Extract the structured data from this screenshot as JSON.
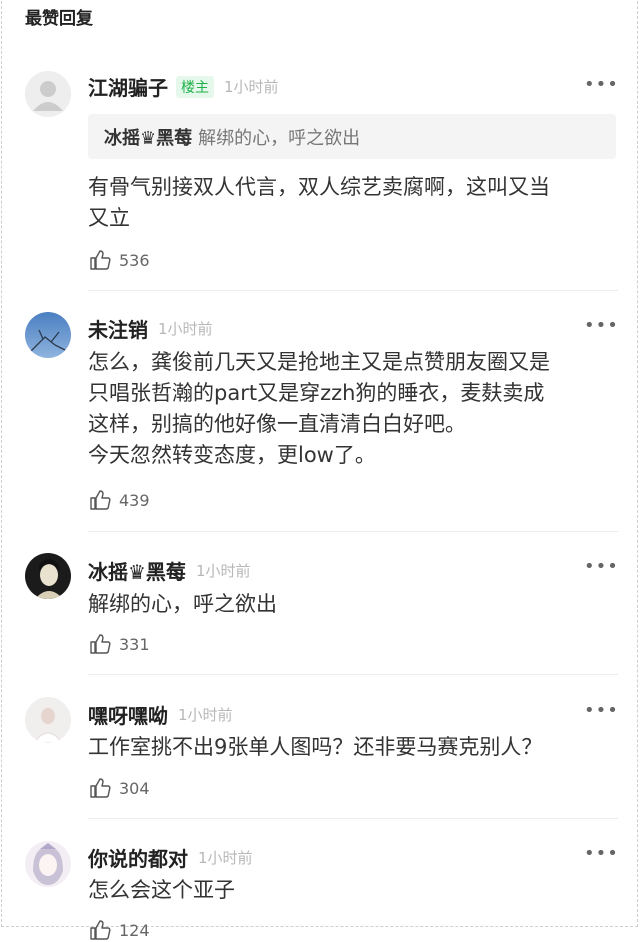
{
  "section_title": "最赞回复",
  "comments": [
    {
      "author": "江湖骗子",
      "badge": "楼主",
      "time": "1小时前",
      "more": "•••",
      "quote": {
        "author": "冰摇♛黑莓",
        "text": "解绑的心，呼之欲出"
      },
      "lines": [
        "有骨气别接双人代言，双人综艺卖腐啊，这叫又当",
        "又立"
      ],
      "likes": "536",
      "avatar": "default-avatar"
    },
    {
      "author": "未注销",
      "time": "1小时前",
      "more": "•••",
      "lines": [
        "怎么，龚俊前几天又是抢地主又是点赞朋友圈又是",
        "只唱张哲瀚的part又是穿zzh狗的睡衣，麦麸卖成",
        "这样，别搞的他好像一直清清白白好吧。",
        "今天忽然转变态度，更low了。"
      ],
      "likes": "439",
      "avatar": "blue-sky-avatar"
    },
    {
      "author": "冰摇♛黑莓",
      "time": "1小时前",
      "more": "•••",
      "lines": [
        "解绑的心，呼之欲出"
      ],
      "likes": "331",
      "avatar": "dark-portrait-avatar"
    },
    {
      "author": "嘿呀嘿呦",
      "time": "1小时前",
      "more": "•••",
      "lines": [
        "工作室挑不出9张单人图吗？还非要马赛克别人？"
      ],
      "likes": "304",
      "avatar": "light-portrait-avatar"
    },
    {
      "author": "你说的都对",
      "time": "1小时前",
      "more": "•••",
      "lines": [
        "怎么会这个亚子"
      ],
      "likes": "124",
      "avatar": "doll-avatar"
    }
  ],
  "colors": {
    "badge_bg": "#e6f7ec",
    "badge_text": "#1fb24a",
    "time": "#b8b8b8"
  },
  "icons": {
    "like": "thumbs-up-icon",
    "more": "more-dots-icon"
  }
}
